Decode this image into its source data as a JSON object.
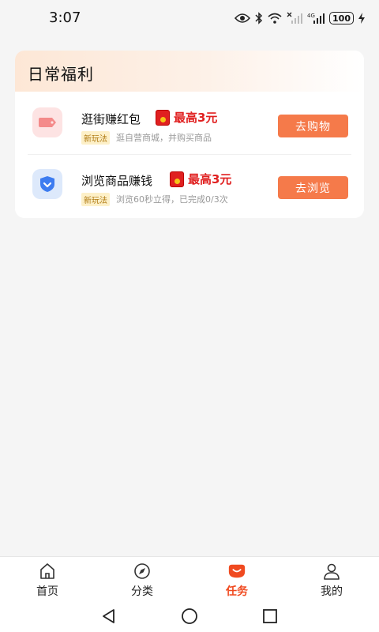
{
  "status_bar": {
    "time": "3:07",
    "battery": "100"
  },
  "section": {
    "title": "日常福利"
  },
  "tasks": [
    {
      "title": "逛街赚红包",
      "reward": "最高3元",
      "badge": "新玩法",
      "description": "逛自营商城，并购买商品",
      "button": "去购物",
      "icon": "price-tag-icon"
    },
    {
      "title": "浏览商品赚钱",
      "reward": "最高3元",
      "badge": "新玩法",
      "description": "浏览60秒立得，已完成0/3次",
      "button": "去浏览",
      "icon": "shield-check-icon"
    }
  ],
  "bottom_nav": {
    "items": [
      {
        "label": "首页",
        "icon": "home-icon"
      },
      {
        "label": "分类",
        "icon": "compass-icon"
      },
      {
        "label": "任务",
        "icon": "task-smile-icon",
        "active": true
      },
      {
        "label": "我的",
        "icon": "person-icon"
      }
    ]
  },
  "colors": {
    "accent": "#f57a4a",
    "reward_red": "#e02020",
    "active_nav": "#f04a20"
  }
}
